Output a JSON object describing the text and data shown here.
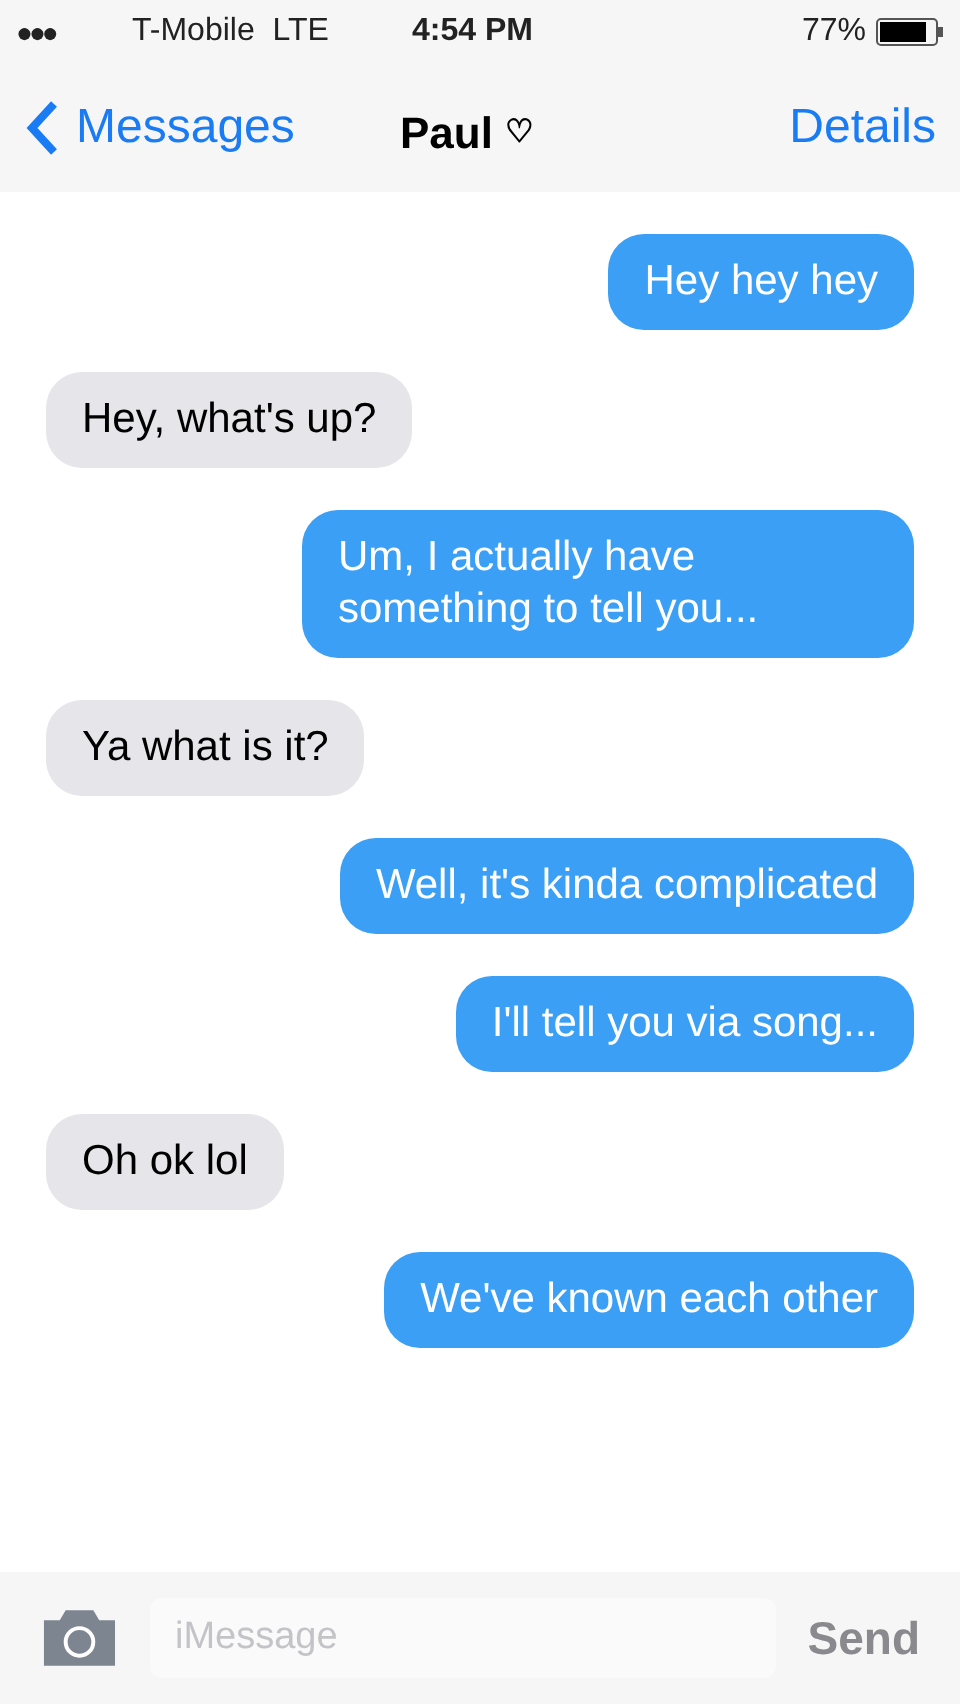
{
  "status_bar": {
    "signal": "●●●",
    "carrier": "T-Mobile  LTE",
    "time": "4:54 PM",
    "battery": "77%"
  },
  "nav": {
    "back": "Messages",
    "title": "Paul",
    "title_icon": "♡",
    "action": "Details"
  },
  "messages": [
    {
      "kind": "sent",
      "text": "Hey hey hey"
    },
    {
      "kind": "received",
      "text": "Hey, what's up?"
    },
    {
      "kind": "sent",
      "text": "Um, I actually have something to tell you..."
    },
    {
      "kind": "received",
      "text": "Ya what is it?"
    },
    {
      "kind": "sent",
      "text": "Well, it's kinda complicated"
    },
    {
      "kind": "sent",
      "text": "I'll tell you via song..."
    },
    {
      "kind": "received",
      "text": "Oh ok lol"
    },
    {
      "kind": "sent",
      "text": "We've known each other"
    }
  ],
  "compose": {
    "placeholder": "iMessage",
    "send": "Send"
  }
}
